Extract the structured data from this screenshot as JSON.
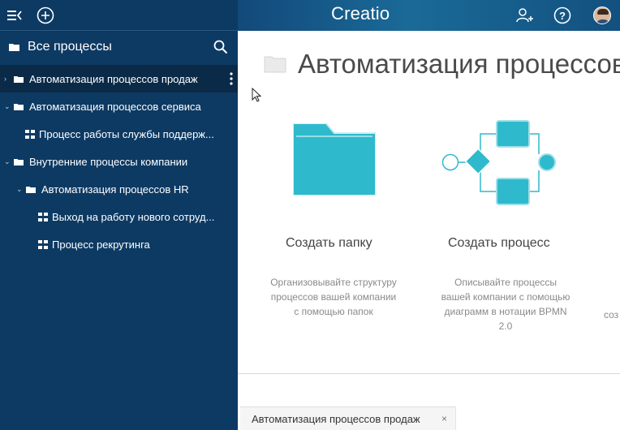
{
  "sidebar": {
    "title": "Все процессы",
    "items": [
      {
        "label": "Автоматизация процессов продаж",
        "kind": "folder",
        "selected": true
      },
      {
        "label": "Автоматизация процессов сервиса",
        "kind": "folder"
      },
      {
        "label": "Процесс работы службы поддерж...",
        "kind": "process"
      },
      {
        "label": "Внутренние процессы компании",
        "kind": "folder"
      },
      {
        "label": "Автоматизация процессов HR",
        "kind": "folder"
      },
      {
        "label": "Выход на работу нового сотруд...",
        "kind": "process"
      },
      {
        "label": "Процесс рекрутинга",
        "kind": "process"
      }
    ]
  },
  "header": {
    "logo": "Creatio"
  },
  "main": {
    "title": "Автоматизация процессов",
    "cards": [
      {
        "title": "Создать папку",
        "description": [
          "Организовывайте структуру",
          "процессов вашей компании",
          "с помощью папок"
        ]
      },
      {
        "title": "Создать процесс",
        "description": [
          "Описывайте процессы",
          "вашей компании с помощью",
          "диаграмм в нотации BPMN",
          "2.0"
        ]
      }
    ],
    "cut_text": "соз"
  },
  "bottom_tab": {
    "label": "Автоматизация процессов продаж",
    "close": "×"
  },
  "colors": {
    "sidebar": "#0d3a63",
    "accent": "#2ebacc",
    "header": "#1a6a98"
  },
  "icons": [
    "menu-collapse-icon",
    "add-icon",
    "search-icon",
    "folder-icon",
    "process-icon",
    "more-icon",
    "add-user-icon",
    "help-icon",
    "avatar"
  ]
}
